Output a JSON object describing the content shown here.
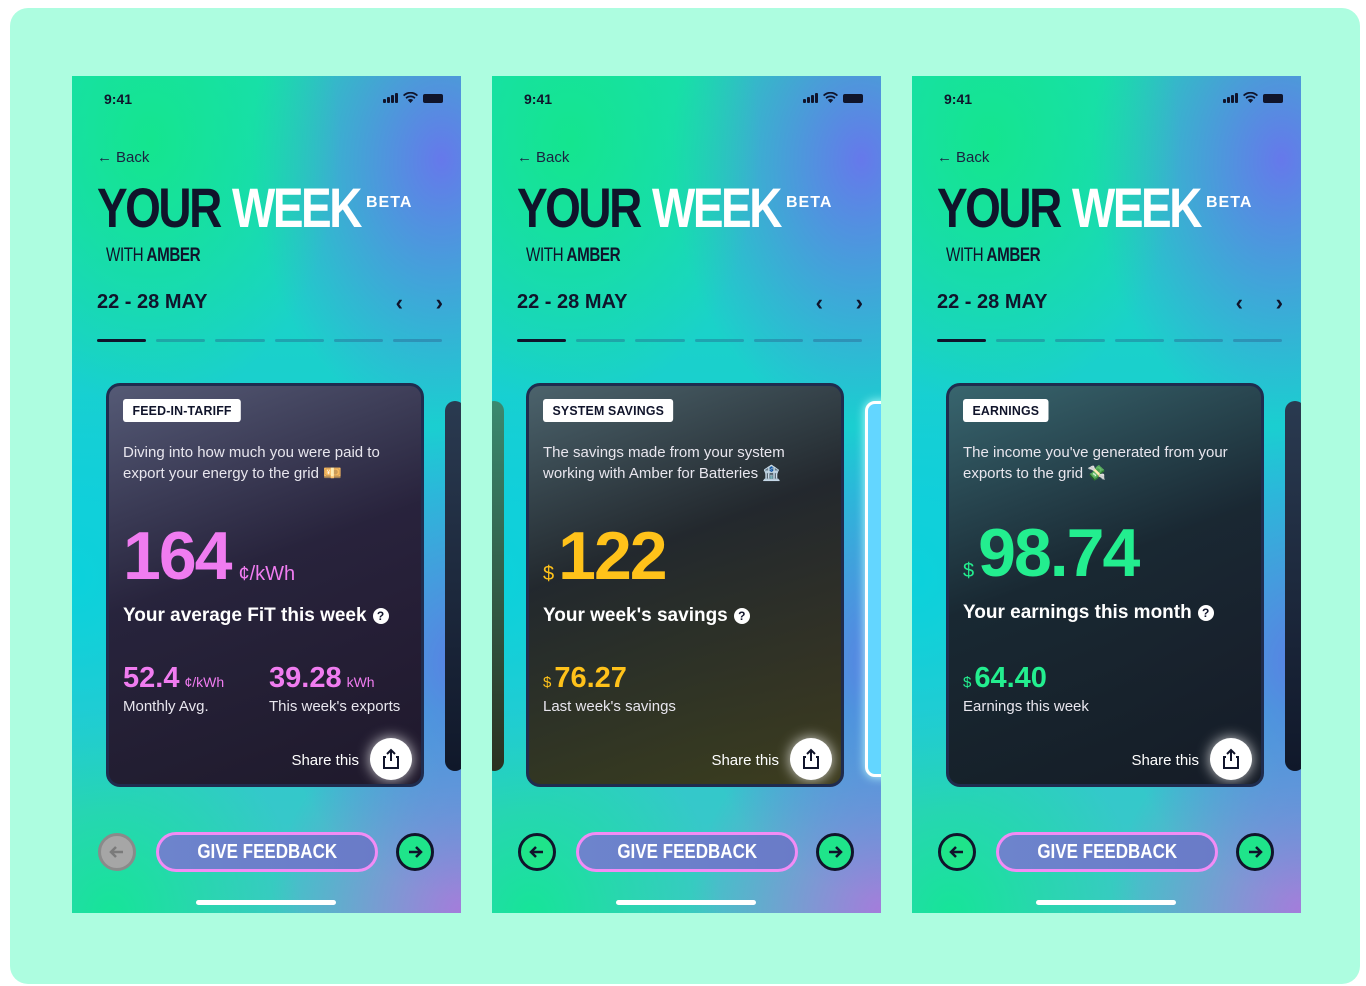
{
  "common": {
    "time": "9:41",
    "back_label": "Back",
    "title_your": "YOUR",
    "title_week": "WEEK",
    "beta": "BETA",
    "with": "WITH",
    "amber": "AMBER",
    "date_range": "22 - 28 MAY",
    "share_label": "Share this",
    "feedback_label": "GIVE FEEDBACK"
  },
  "colors": {
    "board": "#adfde0",
    "fit_accent": "#f07cf0",
    "savings_accent": "#ffc21a",
    "earnings_accent": "#23ee8f",
    "nav_active": "#1fe48a",
    "feedback_border": "#f28cf5"
  },
  "screens": [
    {
      "tag": "FEED-IN-TARIFF",
      "description": "Diving into how much you were paid to export your energy to the grid 💴",
      "big_value": "164",
      "big_unit": "¢/kWh",
      "headline": "Your average FiT this week",
      "stats": [
        {
          "value": "52.4",
          "unit": "¢/kWh",
          "label": "Monthly Avg."
        },
        {
          "value": "39.28",
          "unit": "kWh",
          "label": "This week's exports"
        }
      ],
      "progress_active": 1
    },
    {
      "tag": "SYSTEM SAVINGS",
      "description": "The savings made from your system working with Amber for Batteries 🏦",
      "currency": "$",
      "big_value": "122",
      "headline": "Your week's savings",
      "stats": [
        {
          "currency": "$",
          "value": "76.27",
          "label": "Last week's savings"
        }
      ],
      "progress_active": 1
    },
    {
      "tag": "EARNINGS",
      "description": "The income you've generated from your exports to the grid 💸",
      "currency": "$",
      "big_value": "98.74",
      "headline": "Your earnings this month",
      "stats": [
        {
          "currency": "$",
          "value": "64.40",
          "label": "Earnings this week"
        }
      ],
      "progress_active": 1
    }
  ]
}
